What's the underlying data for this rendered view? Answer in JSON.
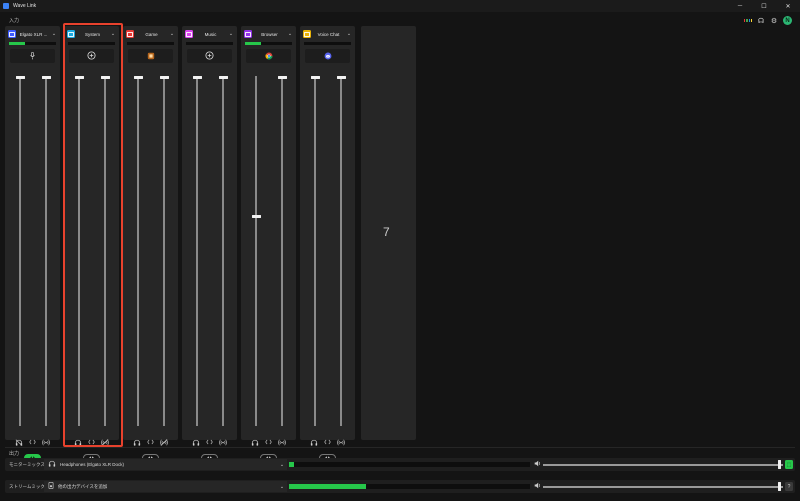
{
  "window": {
    "title": "Wave Link",
    "minimize": "─",
    "maximize": "☐",
    "close": "✕"
  },
  "sections": {
    "inputs_label": "入力",
    "outputs_label": "出力"
  },
  "top_icons": {
    "grid_colors": [
      "#e53935",
      "#43a047",
      "#1e88e5",
      "#fdd835"
    ],
    "headset": "☊",
    "settings": "⚙",
    "avatar": "N"
  },
  "channels": [
    {
      "name": "Elgato XLR ...",
      "color": "#3d5afe",
      "source": "mic",
      "source_icon": "microphone-icon",
      "monitor_fader": 1.0,
      "stream_fader": 1.0,
      "mute_monitor": true,
      "level": 0.35,
      "monitor_active": true
    },
    {
      "name": "System",
      "color": "#1ba9e0",
      "source": "add",
      "source_icon": "add-circle-icon",
      "monitor_fader": 1.0,
      "stream_fader": 1.0,
      "mute_monitor": false,
      "mute_stream": true,
      "level": 0,
      "monitor_active": false
    },
    {
      "name": "Game",
      "color": "#e53935",
      "source": "app",
      "source_icon": "game-app-icon",
      "monitor_fader": 1.0,
      "stream_fader": 1.0,
      "mute_monitor": false,
      "mute_stream": true,
      "level": 0,
      "monitor_active": false
    },
    {
      "name": "Music",
      "color": "#d946ef",
      "source": "add",
      "source_icon": "add-circle-icon",
      "monitor_fader": 1.0,
      "stream_fader": 1.0,
      "mute_monitor": false,
      "level": 0,
      "monitor_active": false
    },
    {
      "name": "Browser",
      "color": "#9333ea",
      "source": "chrome",
      "source_icon": "chrome-icon",
      "monitor_fader": 0.6,
      "stream_fader": 1.0,
      "mute_monitor": false,
      "level": 0.35,
      "monitor_active": false
    },
    {
      "name": "Voice Chat",
      "color": "#eab308",
      "source": "discord",
      "source_icon": "discord-icon",
      "monitor_fader": 1.0,
      "stream_fader": 1.0,
      "mute_monitor": false,
      "level": 0,
      "monitor_active": false
    }
  ],
  "empty_slot_number": "7",
  "outputs": [
    {
      "label": "モニターミックス",
      "device": "Headphones (Elgato XLR Dock)",
      "device_icon": "headphones-icon",
      "level": 0.02,
      "volume": 0.99,
      "button": "monitor",
      "button_color": "#26c74a",
      "button_glyph": "⬚"
    },
    {
      "label": "ストリームミックス",
      "device": "他の出力デバイスを追加",
      "device_icon": "speaker-icon",
      "level": 0.32,
      "volume": 0.99,
      "button": "help",
      "button_color": "#3a3a3a",
      "button_glyph": "?"
    }
  ]
}
